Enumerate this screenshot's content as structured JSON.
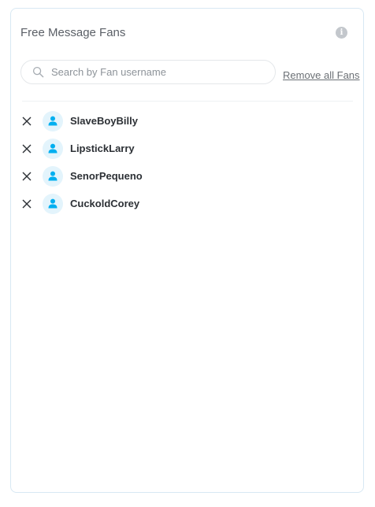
{
  "panel": {
    "title": "Free Message Fans",
    "info_icon": "info-icon"
  },
  "search": {
    "placeholder": "Search by Fan username",
    "value": "",
    "icon": "search-icon"
  },
  "actions": {
    "remove_all_label": "Remove all Fans"
  },
  "fans": [
    {
      "username": "SlaveBoyBilly"
    },
    {
      "username": "LipstickLarry"
    },
    {
      "username": "SenorPequeno"
    },
    {
      "username": "CuckoldCorey"
    }
  ],
  "colors": {
    "accent": "#00aff0",
    "avatar_bg": "#e3f4fc",
    "border": "#d8e8f3"
  }
}
